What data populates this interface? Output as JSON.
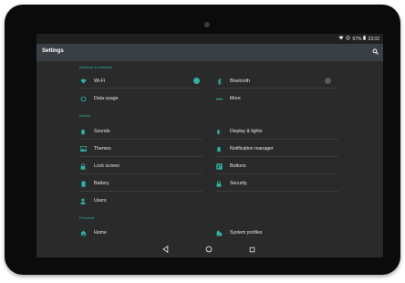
{
  "status_bar": {
    "battery_percent": "67%",
    "time": "23:02"
  },
  "app_bar": {
    "title": "Settings"
  },
  "sections": {
    "wireless": "Wireless & networks",
    "device": "Device",
    "personal": "Personal"
  },
  "items": {
    "wifi": "Wi-Fi",
    "bluetooth": "Bluetooth",
    "data_usage": "Data usage",
    "more": "More",
    "sounds": "Sounds",
    "display": "Display & lights",
    "themes": "Themes",
    "notification_manager": "Notification manager",
    "lock_screen": "Lock screen",
    "buttons": "Buttons",
    "battery": "Battery",
    "security": "Security",
    "users": "Users",
    "home": "Home",
    "system_profiles": "System profiles"
  },
  "toggles": {
    "wifi_on": true,
    "bluetooth_on": false
  },
  "colors": {
    "accent": "#30b3a4",
    "background": "#2a2a2a",
    "app_bar": "#3a3f45"
  }
}
